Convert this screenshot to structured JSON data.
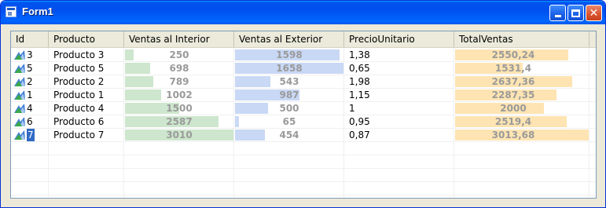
{
  "window": {
    "title": "Form1",
    "icon": "form-icon",
    "controls": [
      "minimize-icon",
      "maximize-icon",
      "close-icon"
    ],
    "close_glyph": "✕"
  },
  "columns": [
    {
      "key": "id",
      "label": "Id"
    },
    {
      "key": "producto",
      "label": "Producto"
    },
    {
      "key": "interior",
      "label": "Ventas al Interior"
    },
    {
      "key": "exterior",
      "label": "Ventas al Exterior"
    },
    {
      "key": "precio",
      "label": "PrecioUnitario"
    },
    {
      "key": "total",
      "label": "TotalVentas"
    }
  ],
  "bar_colors": {
    "interior": "#cde6cd",
    "exterior": "#c8d8f5",
    "total": "#fde4b2"
  },
  "bar_max": {
    "interior": 3010,
    "exterior": 1658,
    "total": 3013.68
  },
  "rows": [
    {
      "id": "3",
      "producto": "Producto 3",
      "interior": "250",
      "exterior": "1598",
      "precio": "1,38",
      "total": "2550,24",
      "interior_v": 250,
      "exterior_v": 1598,
      "total_v": 2550.24
    },
    {
      "id": "5",
      "producto": "Producto 5",
      "interior": "698",
      "exterior": "1658",
      "precio": "0,65",
      "total": "1531,4",
      "interior_v": 698,
      "exterior_v": 1658,
      "total_v": 1531.4
    },
    {
      "id": "2",
      "producto": "Producto 2",
      "interior": "789",
      "exterior": "543",
      "precio": "1,98",
      "total": "2637,36",
      "interior_v": 789,
      "exterior_v": 543,
      "total_v": 2637.36
    },
    {
      "id": "1",
      "producto": "Producto 1",
      "interior": "1002",
      "exterior": "987",
      "precio": "1,15",
      "total": "2287,35",
      "interior_v": 1002,
      "exterior_v": 987,
      "total_v": 2287.35
    },
    {
      "id": "4",
      "producto": "Producto 4",
      "interior": "1500",
      "exterior": "500",
      "precio": "1",
      "total": "2000",
      "interior_v": 1500,
      "exterior_v": 500,
      "total_v": 2000
    },
    {
      "id": "6",
      "producto": "Producto 6",
      "interior": "2587",
      "exterior": "65",
      "precio": "0,95",
      "total": "2519,4",
      "interior_v": 2587,
      "exterior_v": 65,
      "total_v": 2519.4
    },
    {
      "id": "7",
      "producto": "Producto 7",
      "interior": "3010",
      "exterior": "454",
      "precio": "0,87",
      "total": "3013,68",
      "interior_v": 3010,
      "exterior_v": 454,
      "total_v": 3013.68
    }
  ],
  "selected_row_id": "7",
  "row_icon": "product-chart-icon"
}
